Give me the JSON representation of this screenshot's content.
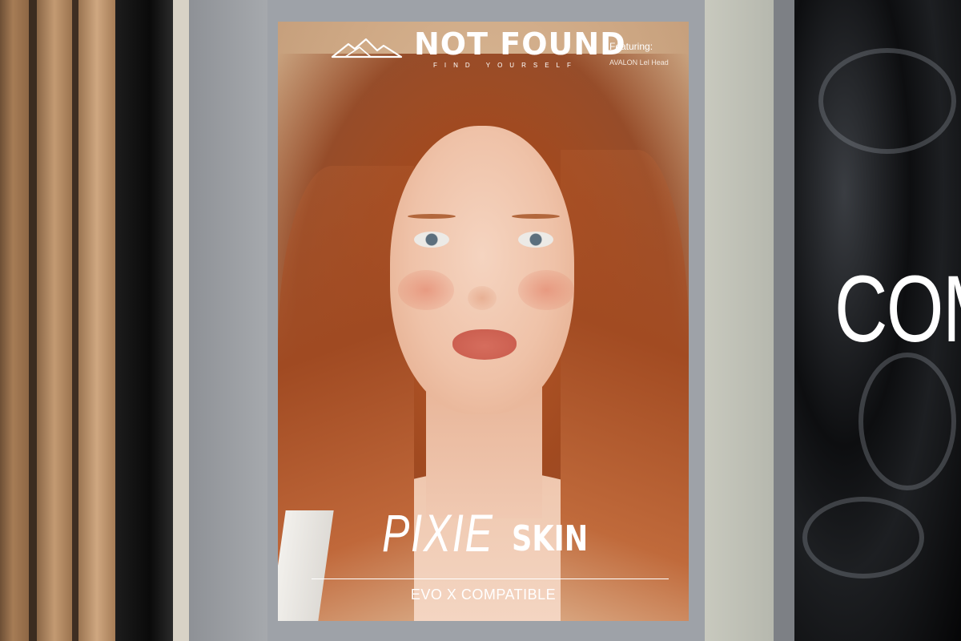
{
  "poster": {
    "brand_name": "NOT FOUND",
    "brand_tagline": "FIND YOURSELF",
    "featuring_label": "Featuring:",
    "featuring_head": "AVALON Lel Head",
    "title_light": "PIXIE",
    "title_bold": "SKIN",
    "subtitle": "EVO X COMPATIBLE",
    "logo_icon": "mountain-icon"
  },
  "side_sign": {
    "text": "COM"
  },
  "colors": {
    "background_poster": "#cfa985",
    "hair": "#a14a20",
    "black_panel": "#0d0e10",
    "text": "#ffffff"
  }
}
